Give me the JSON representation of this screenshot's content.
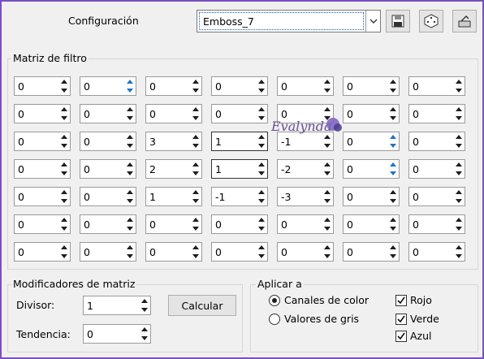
{
  "header": {
    "config_label": "Configuración",
    "preset_value": "Emboss_7",
    "save_icon": "save-icon",
    "random_icon": "dice-icon",
    "reset_icon": "reset-icon"
  },
  "matrix": {
    "title": "Matriz de filtro",
    "rows": [
      [
        "0",
        "0",
        "0",
        "0",
        "0",
        "0",
        "0"
      ],
      [
        "0",
        "0",
        "0",
        "0",
        "0",
        "0",
        "0"
      ],
      [
        "0",
        "0",
        "3",
        "1",
        "-1",
        "0",
        "0"
      ],
      [
        "0",
        "0",
        "2",
        "1",
        "-2",
        "0",
        "0"
      ],
      [
        "0",
        "0",
        "1",
        "-1",
        "-3",
        "0",
        "0"
      ],
      [
        "0",
        "0",
        "0",
        "0",
        "0",
        "0",
        "0"
      ],
      [
        "0",
        "0",
        "0",
        "0",
        "0",
        "0",
        "0"
      ]
    ]
  },
  "watermark_text": "Evalynda",
  "modifiers": {
    "title": "Modificadores de matriz",
    "divisor_label": "Divisor:",
    "divisor_value": "1",
    "bias_label": "Tendencia:",
    "bias_value": "0",
    "calc_label": "Calcular"
  },
  "apply": {
    "title": "Aplicar a",
    "radio_color": "Canales de color",
    "radio_gray": "Valores de gris",
    "selected": "color",
    "red": "Rojo",
    "green": "Verde",
    "blue": "Azul"
  }
}
